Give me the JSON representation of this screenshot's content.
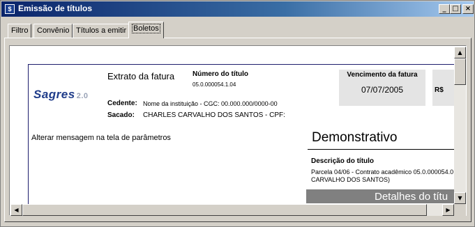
{
  "window": {
    "title": "Emissão de títulos",
    "icon": "app-icon",
    "controls": {
      "minimize": "_",
      "maximize": "□",
      "close": "×"
    }
  },
  "tabs": [
    {
      "label": "Filtro"
    },
    {
      "label": "Convênio"
    },
    {
      "label": "Títulos a emitir"
    },
    {
      "label": "Boletos",
      "active": true
    }
  ],
  "document": {
    "logo_text": "Sagres",
    "logo_version": "2.0",
    "extrato_title": "Extrato da fatura",
    "numero_label": "Número do título",
    "numero_value": "05.0.000054.1.04",
    "vencimento_label": "Vencimento da fatura",
    "vencimento_value": "07/07/2005",
    "valor_label": "R$",
    "cedente_label": "Cedente:",
    "cedente_value": "Nome da instituição  -  CGC: 00.000.000/0000-00",
    "sacado_label": "Sacado:",
    "sacado_value": "CHARLES CARVALHO DOS SANTOS  -  CPF:",
    "mensagem": "Alterar mensagem na tela de parâmetros",
    "demonstrativo_title": "Demonstrativo",
    "descricao_label": "Descrição do título",
    "descricao_value": "Parcela 04/06 - Contrato acadêmico 05.0.000054.0 CARVALHO DOS SANTOS)",
    "detalhes_title": "Detalhes do títu"
  },
  "colors": {
    "titlebar_start": "#0a246a",
    "titlebar_end": "#a6caf0",
    "logo": "#1f3c8a",
    "box_gray": "#e4e4e4",
    "detalhes_bar": "#808080"
  }
}
